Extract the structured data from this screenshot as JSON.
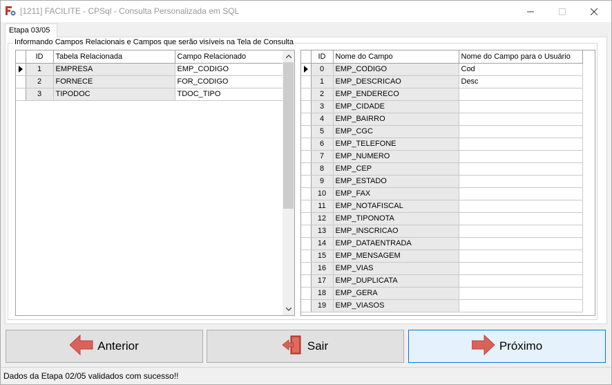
{
  "window": {
    "title": "[1211] FACILITE - CPSql - Consulta Personalizada em SQL",
    "app_icon": "facilite-app-icon"
  },
  "tab": {
    "label": "Etapa 03/05"
  },
  "group": {
    "label": "Informando Campos Relacionais e Campos que serão visíveis na Tela de Consulta"
  },
  "left_grid": {
    "columns": [
      "ID",
      "Tabela Relacionada",
      "Campo Relacionado"
    ],
    "rows": [
      {
        "id": "1",
        "table": "EMPRESA",
        "field": "EMP_CODIGO"
      },
      {
        "id": "2",
        "table": "FORNECE",
        "field": "FOR_CODIGO"
      },
      {
        "id": "3",
        "table": "TIPODOC",
        "field": "TDOC_TIPO"
      }
    ]
  },
  "right_grid": {
    "columns": [
      "ID",
      "Nome do Campo",
      "Nome do Campo para o Usuário"
    ],
    "rows": [
      {
        "id": "0",
        "name": "EMP_CODIGO",
        "user": "Cod"
      },
      {
        "id": "1",
        "name": "EMP_DESCRICAO",
        "user": "Desc"
      },
      {
        "id": "2",
        "name": "EMP_ENDERECO",
        "user": ""
      },
      {
        "id": "3",
        "name": "EMP_CIDADE",
        "user": ""
      },
      {
        "id": "4",
        "name": "EMP_BAIRRO",
        "user": ""
      },
      {
        "id": "5",
        "name": "EMP_CGC",
        "user": ""
      },
      {
        "id": "6",
        "name": "EMP_TELEFONE",
        "user": ""
      },
      {
        "id": "7",
        "name": "EMP_NUMERO",
        "user": ""
      },
      {
        "id": "8",
        "name": "EMP_CEP",
        "user": ""
      },
      {
        "id": "9",
        "name": "EMP_ESTADO",
        "user": ""
      },
      {
        "id": "10",
        "name": "EMP_FAX",
        "user": ""
      },
      {
        "id": "11",
        "name": "EMP_NOTAFISCAL",
        "user": ""
      },
      {
        "id": "12",
        "name": "EMP_TIPONOTA",
        "user": ""
      },
      {
        "id": "13",
        "name": "EMP_INSCRICAO",
        "user": ""
      },
      {
        "id": "14",
        "name": "EMP_DATAENTRADA",
        "user": ""
      },
      {
        "id": "15",
        "name": "EMP_MENSAGEM",
        "user": ""
      },
      {
        "id": "16",
        "name": "EMP_VIAS",
        "user": ""
      },
      {
        "id": "17",
        "name": "EMP_DUPLICATA",
        "user": ""
      },
      {
        "id": "18",
        "name": "EMP_GERA",
        "user": ""
      },
      {
        "id": "19",
        "name": "EMP_VIASOS",
        "user": ""
      }
    ]
  },
  "buttons": {
    "prev_label": "Anterior",
    "exit_label": "Sair",
    "next_label": "Próximo",
    "prev_icon": "arrow-left-icon",
    "exit_icon": "exit-door-icon",
    "next_icon": "arrow-right-icon"
  },
  "status": {
    "text": "Dados da Etapa 02/05 validados com sucesso!!"
  },
  "colors": {
    "arrow_red": "#d9635a",
    "accent_blue": "#0078d7"
  }
}
